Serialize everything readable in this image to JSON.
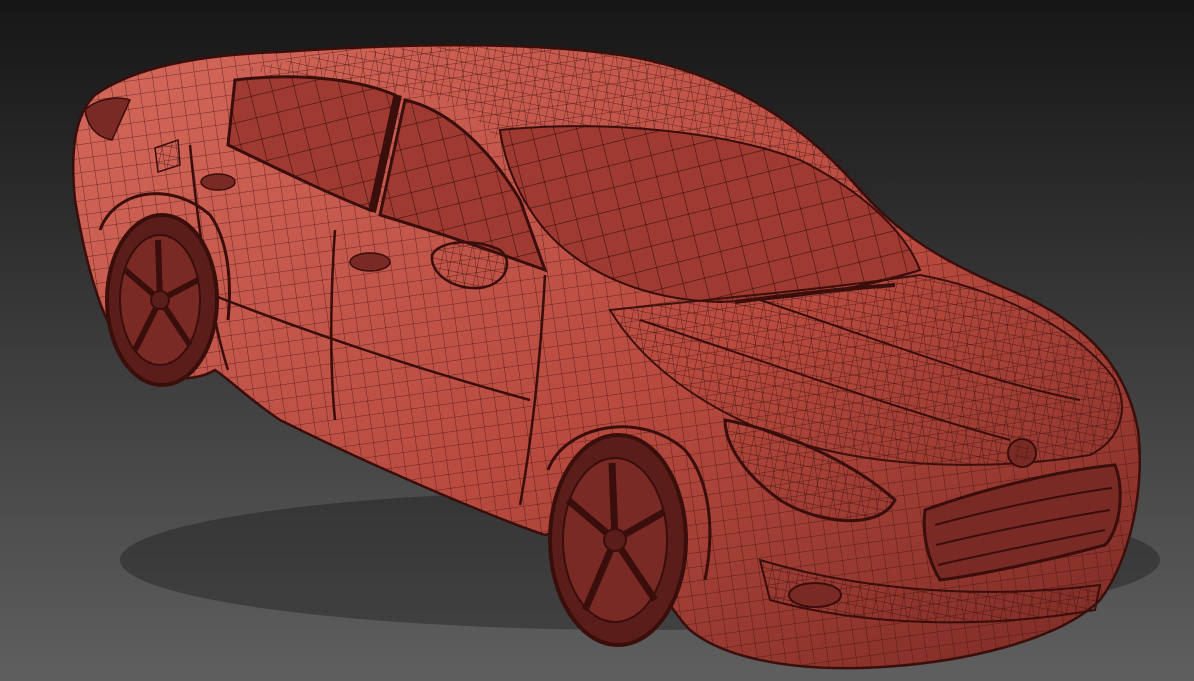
{
  "viewport": {
    "name": "3d-viewport",
    "subject": "car-wireframe-model",
    "icon": "car-icon"
  },
  "colors": {
    "bg_top": "#161616",
    "bg_bottom": "#5f5f5f",
    "body": "#b84a3f",
    "body_light": "#d3685b",
    "body_dark": "#7a2a24",
    "wire": "#3a0e0b",
    "tire": "#5a1d19",
    "glass": "#9e3a31"
  }
}
